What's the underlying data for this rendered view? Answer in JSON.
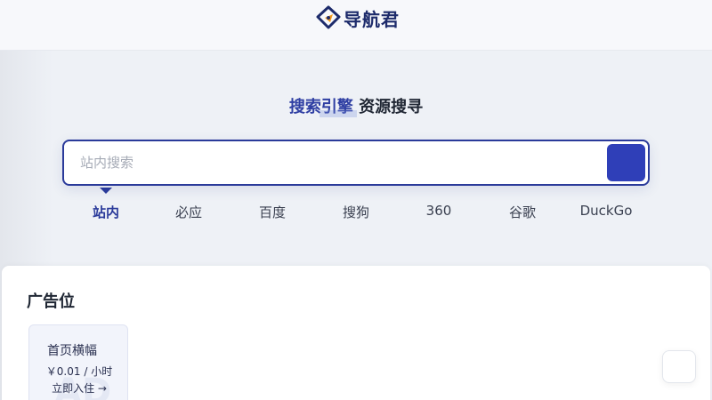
{
  "header": {
    "logo_icon": "compass-logo-icon",
    "logo_text": "导航君"
  },
  "search": {
    "title_highlight": "搜索引擎",
    "title_rest": " 资源搜寻",
    "placeholder": "站内搜索",
    "value": "",
    "button_icon": "search-icon",
    "engines": [
      {
        "label": "站内",
        "active": true
      },
      {
        "label": "必应",
        "active": false
      },
      {
        "label": "百度",
        "active": false
      },
      {
        "label": "搜狗",
        "active": false
      },
      {
        "label": "360",
        "active": false
      },
      {
        "label": "谷歌",
        "active": false
      },
      {
        "label": "DuckGo",
        "active": false
      }
    ]
  },
  "ads": {
    "heading": "广告位",
    "card": {
      "title": "首页横幅",
      "price": "￥0.01 / 小时",
      "cta": "立即入住 →"
    }
  },
  "colors": {
    "accent": "#2f3fb8",
    "brand_dark": "#1d2b6b",
    "logo_orange": "#f59a1b"
  }
}
